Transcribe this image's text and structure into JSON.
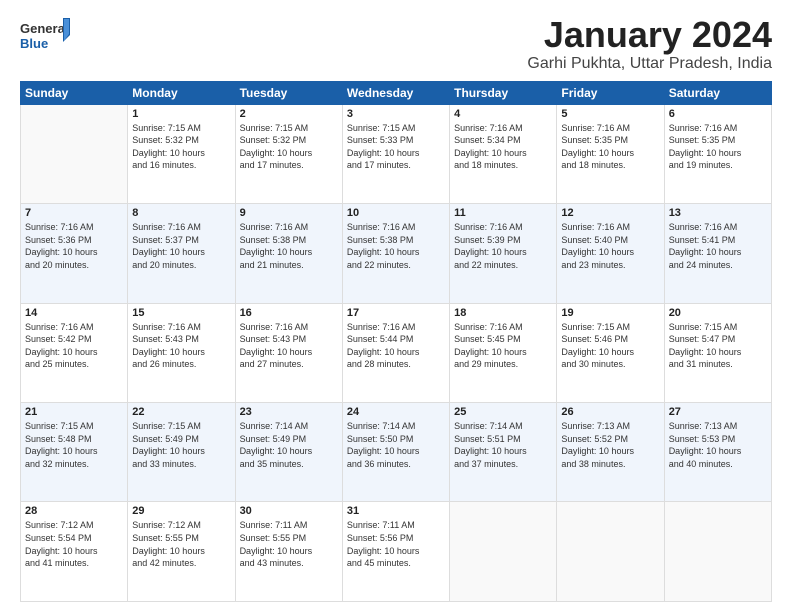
{
  "header": {
    "logo_general": "General",
    "logo_blue": "Blue",
    "month_title": "January 2024",
    "location": "Garhi Pukhta, Uttar Pradesh, India"
  },
  "weekdays": [
    "Sunday",
    "Monday",
    "Tuesday",
    "Wednesday",
    "Thursday",
    "Friday",
    "Saturday"
  ],
  "weeks": [
    [
      {
        "day": "",
        "info": ""
      },
      {
        "day": "1",
        "info": "Sunrise: 7:15 AM\nSunset: 5:32 PM\nDaylight: 10 hours\nand 16 minutes."
      },
      {
        "day": "2",
        "info": "Sunrise: 7:15 AM\nSunset: 5:32 PM\nDaylight: 10 hours\nand 17 minutes."
      },
      {
        "day": "3",
        "info": "Sunrise: 7:15 AM\nSunset: 5:33 PM\nDaylight: 10 hours\nand 17 minutes."
      },
      {
        "day": "4",
        "info": "Sunrise: 7:16 AM\nSunset: 5:34 PM\nDaylight: 10 hours\nand 18 minutes."
      },
      {
        "day": "5",
        "info": "Sunrise: 7:16 AM\nSunset: 5:35 PM\nDaylight: 10 hours\nand 18 minutes."
      },
      {
        "day": "6",
        "info": "Sunrise: 7:16 AM\nSunset: 5:35 PM\nDaylight: 10 hours\nand 19 minutes."
      }
    ],
    [
      {
        "day": "7",
        "info": "Sunrise: 7:16 AM\nSunset: 5:36 PM\nDaylight: 10 hours\nand 20 minutes."
      },
      {
        "day": "8",
        "info": "Sunrise: 7:16 AM\nSunset: 5:37 PM\nDaylight: 10 hours\nand 20 minutes."
      },
      {
        "day": "9",
        "info": "Sunrise: 7:16 AM\nSunset: 5:38 PM\nDaylight: 10 hours\nand 21 minutes."
      },
      {
        "day": "10",
        "info": "Sunrise: 7:16 AM\nSunset: 5:38 PM\nDaylight: 10 hours\nand 22 minutes."
      },
      {
        "day": "11",
        "info": "Sunrise: 7:16 AM\nSunset: 5:39 PM\nDaylight: 10 hours\nand 22 minutes."
      },
      {
        "day": "12",
        "info": "Sunrise: 7:16 AM\nSunset: 5:40 PM\nDaylight: 10 hours\nand 23 minutes."
      },
      {
        "day": "13",
        "info": "Sunrise: 7:16 AM\nSunset: 5:41 PM\nDaylight: 10 hours\nand 24 minutes."
      }
    ],
    [
      {
        "day": "14",
        "info": "Sunrise: 7:16 AM\nSunset: 5:42 PM\nDaylight: 10 hours\nand 25 minutes."
      },
      {
        "day": "15",
        "info": "Sunrise: 7:16 AM\nSunset: 5:43 PM\nDaylight: 10 hours\nand 26 minutes."
      },
      {
        "day": "16",
        "info": "Sunrise: 7:16 AM\nSunset: 5:43 PM\nDaylight: 10 hours\nand 27 minutes."
      },
      {
        "day": "17",
        "info": "Sunrise: 7:16 AM\nSunset: 5:44 PM\nDaylight: 10 hours\nand 28 minutes."
      },
      {
        "day": "18",
        "info": "Sunrise: 7:16 AM\nSunset: 5:45 PM\nDaylight: 10 hours\nand 29 minutes."
      },
      {
        "day": "19",
        "info": "Sunrise: 7:15 AM\nSunset: 5:46 PM\nDaylight: 10 hours\nand 30 minutes."
      },
      {
        "day": "20",
        "info": "Sunrise: 7:15 AM\nSunset: 5:47 PM\nDaylight: 10 hours\nand 31 minutes."
      }
    ],
    [
      {
        "day": "21",
        "info": "Sunrise: 7:15 AM\nSunset: 5:48 PM\nDaylight: 10 hours\nand 32 minutes."
      },
      {
        "day": "22",
        "info": "Sunrise: 7:15 AM\nSunset: 5:49 PM\nDaylight: 10 hours\nand 33 minutes."
      },
      {
        "day": "23",
        "info": "Sunrise: 7:14 AM\nSunset: 5:49 PM\nDaylight: 10 hours\nand 35 minutes."
      },
      {
        "day": "24",
        "info": "Sunrise: 7:14 AM\nSunset: 5:50 PM\nDaylight: 10 hours\nand 36 minutes."
      },
      {
        "day": "25",
        "info": "Sunrise: 7:14 AM\nSunset: 5:51 PM\nDaylight: 10 hours\nand 37 minutes."
      },
      {
        "day": "26",
        "info": "Sunrise: 7:13 AM\nSunset: 5:52 PM\nDaylight: 10 hours\nand 38 minutes."
      },
      {
        "day": "27",
        "info": "Sunrise: 7:13 AM\nSunset: 5:53 PM\nDaylight: 10 hours\nand 40 minutes."
      }
    ],
    [
      {
        "day": "28",
        "info": "Sunrise: 7:12 AM\nSunset: 5:54 PM\nDaylight: 10 hours\nand 41 minutes."
      },
      {
        "day": "29",
        "info": "Sunrise: 7:12 AM\nSunset: 5:55 PM\nDaylight: 10 hours\nand 42 minutes."
      },
      {
        "day": "30",
        "info": "Sunrise: 7:11 AM\nSunset: 5:55 PM\nDaylight: 10 hours\nand 43 minutes."
      },
      {
        "day": "31",
        "info": "Sunrise: 7:11 AM\nSunset: 5:56 PM\nDaylight: 10 hours\nand 45 minutes."
      },
      {
        "day": "",
        "info": ""
      },
      {
        "day": "",
        "info": ""
      },
      {
        "day": "",
        "info": ""
      }
    ]
  ]
}
